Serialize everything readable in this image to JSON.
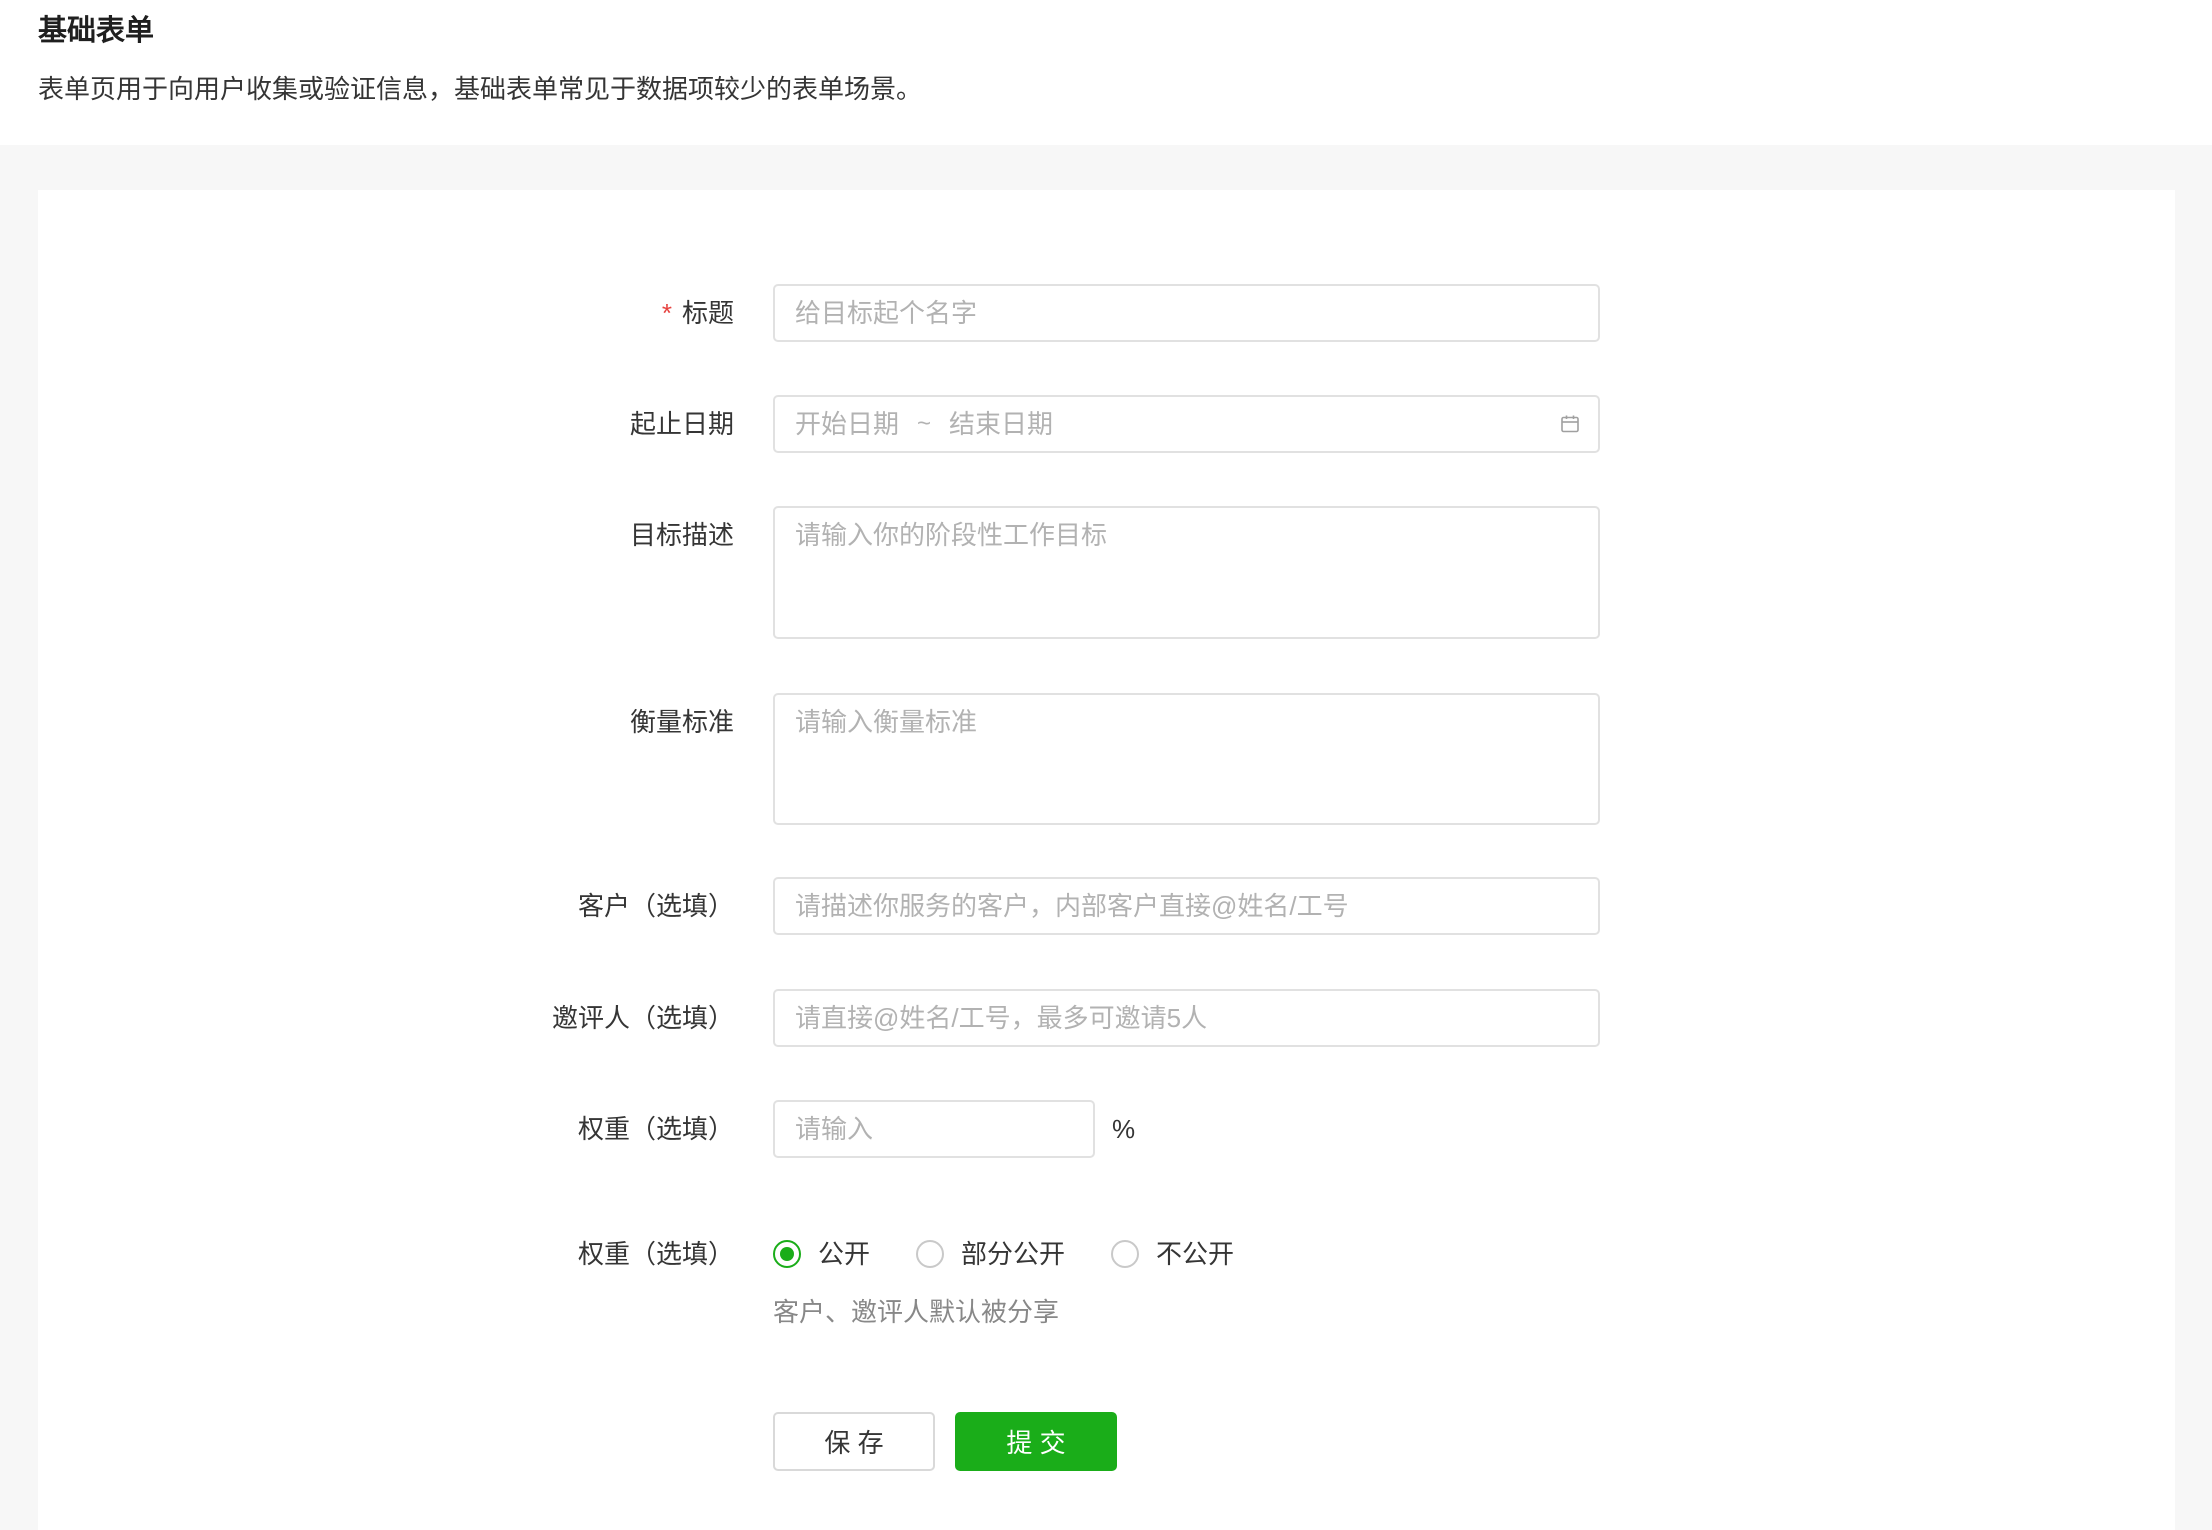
{
  "page": {
    "title": "基础表单",
    "description": "表单页用于向用户收集或验证信息，基础表单常见于数据项较少的表单场景。"
  },
  "form": {
    "title_field": {
      "required_mark": "*",
      "label": "标题",
      "placeholder": "给目标起个名字",
      "value": ""
    },
    "date_range": {
      "label": "起止日期",
      "start_placeholder": "开始日期",
      "separator": "~",
      "end_placeholder": "结束日期",
      "start_value": "",
      "end_value": ""
    },
    "goal_description": {
      "label": "目标描述",
      "placeholder": "请输入你的阶段性工作目标",
      "value": ""
    },
    "metrics": {
      "label": "衡量标准",
      "placeholder": "请输入衡量标准",
      "value": ""
    },
    "client": {
      "label": "客户（选填）",
      "placeholder": "请描述你服务的客户，内部客户直接@姓名/工号",
      "value": ""
    },
    "reviewers": {
      "label": "邀评人（选填）",
      "placeholder": "请直接@姓名/工号，最多可邀请5人",
      "value": ""
    },
    "weight": {
      "label": "权重（选填）",
      "placeholder": "请输入",
      "value": "",
      "unit": "%"
    },
    "visibility": {
      "label": "权重（选填）",
      "selected_index": 0,
      "options": [
        {
          "label": "公开"
        },
        {
          "label": "部分公开"
        },
        {
          "label": "不公开"
        }
      ],
      "hint": "客户、邀评人默认被分享"
    }
  },
  "actions": {
    "save_label": "保 存",
    "submit_label": "提 交"
  },
  "icons": {
    "date_picker": "calendar-icon"
  },
  "colors": {
    "primary": "#1aad19",
    "required": "#e64340",
    "border": "#e1e1e1",
    "placeholder": "#b2b2b2",
    "text": "#353535",
    "hint": "#888888",
    "page_background": "#f7f7f7"
  }
}
